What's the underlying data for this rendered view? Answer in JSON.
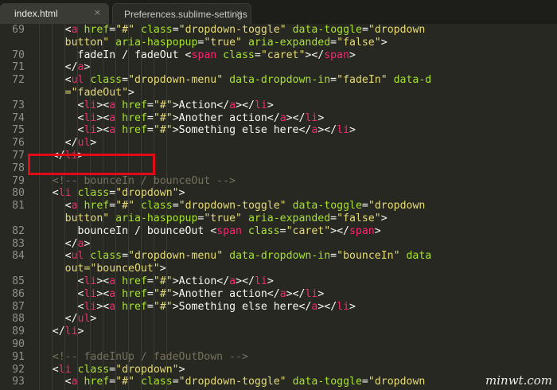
{
  "tabs": [
    {
      "label": "index.html",
      "close": "×",
      "active": true
    },
    {
      "label": "Preferences.sublime-settings",
      "close": "×",
      "active": false
    }
  ],
  "lines": [
    {
      "n": "69",
      "tokens": [
        [
          "p",
          "      "
        ],
        [
          "p",
          "<"
        ],
        [
          "t",
          "a"
        ],
        [
          "p",
          " "
        ],
        [
          "a",
          "href"
        ],
        [
          "p",
          "="
        ],
        [
          "s",
          "\"#\""
        ],
        [
          "p",
          " "
        ],
        [
          "a",
          "class"
        ],
        [
          "p",
          "="
        ],
        [
          "s",
          "\"dropdown-toggle\""
        ],
        [
          "p",
          " "
        ],
        [
          "a",
          "data-toggle"
        ],
        [
          "p",
          "="
        ],
        [
          "s",
          "\"dropdown"
        ]
      ]
    },
    {
      "n": "",
      "tokens": [
        [
          "s",
          "      button\""
        ],
        [
          "p",
          " "
        ],
        [
          "a",
          "aria-haspopup"
        ],
        [
          "p",
          "="
        ],
        [
          "s",
          "\"true\""
        ],
        [
          "p",
          " "
        ],
        [
          "a",
          "aria-expanded"
        ],
        [
          "p",
          "="
        ],
        [
          "s",
          "\"false\""
        ],
        [
          "p",
          ">"
        ]
      ]
    },
    {
      "n": "70",
      "tokens": [
        [
          "p",
          "        fadeIn / fadeOut "
        ],
        [
          "p",
          "<"
        ],
        [
          "t",
          "span"
        ],
        [
          "p",
          " "
        ],
        [
          "a",
          "class"
        ],
        [
          "p",
          "="
        ],
        [
          "s",
          "\"caret\""
        ],
        [
          "p",
          "></"
        ],
        [
          "t",
          "span"
        ],
        [
          "p",
          ">"
        ]
      ]
    },
    {
      "n": "71",
      "tokens": [
        [
          "p",
          "      </"
        ],
        [
          "t",
          "a"
        ],
        [
          "p",
          ">"
        ]
      ]
    },
    {
      "n": "72",
      "tokens": [
        [
          "p",
          "      <"
        ],
        [
          "t",
          "ul"
        ],
        [
          "p",
          " "
        ],
        [
          "a",
          "class"
        ],
        [
          "p",
          "="
        ],
        [
          "s",
          "\"dropdown-menu\""
        ],
        [
          "p",
          " "
        ],
        [
          "a",
          "data-dropdown-in"
        ],
        [
          "p",
          "="
        ],
        [
          "s",
          "\"fadeIn\""
        ],
        [
          "p",
          " "
        ],
        [
          "a",
          "data-d"
        ]
      ]
    },
    {
      "n": "",
      "tokens": [
        [
          "s",
          "      =\"fadeOut\""
        ],
        [
          "p",
          ">"
        ]
      ]
    },
    {
      "n": "73",
      "tokens": [
        [
          "p",
          "        <"
        ],
        [
          "t",
          "li"
        ],
        [
          "p",
          "><"
        ],
        [
          "t",
          "a"
        ],
        [
          "p",
          " "
        ],
        [
          "a",
          "href"
        ],
        [
          "p",
          "="
        ],
        [
          "s",
          "\"#\""
        ],
        [
          "p",
          ">Action</"
        ],
        [
          "t",
          "a"
        ],
        [
          "p",
          "></"
        ],
        [
          "t",
          "li"
        ],
        [
          "p",
          ">"
        ]
      ]
    },
    {
      "n": "74",
      "tokens": [
        [
          "p",
          "        <"
        ],
        [
          "t",
          "li"
        ],
        [
          "p",
          "><"
        ],
        [
          "t",
          "a"
        ],
        [
          "p",
          " "
        ],
        [
          "a",
          "href"
        ],
        [
          "p",
          "="
        ],
        [
          "s",
          "\"#\""
        ],
        [
          "p",
          ">Another action</"
        ],
        [
          "t",
          "a"
        ],
        [
          "p",
          "></"
        ],
        [
          "t",
          "li"
        ],
        [
          "p",
          ">"
        ]
      ]
    },
    {
      "n": "75",
      "tokens": [
        [
          "p",
          "        <"
        ],
        [
          "t",
          "li"
        ],
        [
          "p",
          "><"
        ],
        [
          "t",
          "a"
        ],
        [
          "p",
          " "
        ],
        [
          "a",
          "href"
        ],
        [
          "p",
          "="
        ],
        [
          "s",
          "\"#\""
        ],
        [
          "p",
          ">Something else here</"
        ],
        [
          "t",
          "a"
        ],
        [
          "p",
          "></"
        ],
        [
          "t",
          "li"
        ],
        [
          "p",
          ">"
        ]
      ]
    },
    {
      "n": "76",
      "tokens": [
        [
          "p",
          "      </"
        ],
        [
          "t",
          "ul"
        ],
        [
          "p",
          ">"
        ]
      ]
    },
    {
      "n": "77",
      "tokens": [
        [
          "p",
          "    </"
        ],
        [
          "t",
          "li"
        ],
        [
          "p",
          ">"
        ]
      ]
    },
    {
      "n": "78",
      "tokens": []
    },
    {
      "n": "79",
      "tokens": [
        [
          "c",
          "    <!-- bounceIn / bounceOut -->"
        ]
      ]
    },
    {
      "n": "80",
      "tokens": [
        [
          "p",
          "    <"
        ],
        [
          "t",
          "li"
        ],
        [
          "p",
          " "
        ],
        [
          "a",
          "class"
        ],
        [
          "p",
          "="
        ],
        [
          "s",
          "\"dropdown\""
        ],
        [
          "p",
          ">"
        ]
      ]
    },
    {
      "n": "81",
      "tokens": [
        [
          "p",
          "      <"
        ],
        [
          "t",
          "a"
        ],
        [
          "p",
          " "
        ],
        [
          "a",
          "href"
        ],
        [
          "p",
          "="
        ],
        [
          "s",
          "\"#\""
        ],
        [
          "p",
          " "
        ],
        [
          "a",
          "class"
        ],
        [
          "p",
          "="
        ],
        [
          "s",
          "\"dropdown-toggle\""
        ],
        [
          "p",
          " "
        ],
        [
          "a",
          "data-toggle"
        ],
        [
          "p",
          "="
        ],
        [
          "s",
          "\"dropdown"
        ]
      ]
    },
    {
      "n": "",
      "tokens": [
        [
          "s",
          "      button\""
        ],
        [
          "p",
          " "
        ],
        [
          "a",
          "aria-haspopup"
        ],
        [
          "p",
          "="
        ],
        [
          "s",
          "\"true\""
        ],
        [
          "p",
          " "
        ],
        [
          "a",
          "aria-expanded"
        ],
        [
          "p",
          "="
        ],
        [
          "s",
          "\"false\""
        ],
        [
          "p",
          ">"
        ]
      ]
    },
    {
      "n": "82",
      "tokens": [
        [
          "p",
          "        bounceIn / bounceOut "
        ],
        [
          "p",
          "<"
        ],
        [
          "t",
          "span"
        ],
        [
          "p",
          " "
        ],
        [
          "a",
          "class"
        ],
        [
          "p",
          "="
        ],
        [
          "s",
          "\"caret\""
        ],
        [
          "p",
          "></"
        ],
        [
          "t",
          "span"
        ],
        [
          "p",
          ">"
        ]
      ]
    },
    {
      "n": "83",
      "tokens": [
        [
          "p",
          "      </"
        ],
        [
          "t",
          "a"
        ],
        [
          "p",
          ">"
        ]
      ]
    },
    {
      "n": "84",
      "tokens": [
        [
          "p",
          "      <"
        ],
        [
          "t",
          "ul"
        ],
        [
          "p",
          " "
        ],
        [
          "a",
          "class"
        ],
        [
          "p",
          "="
        ],
        [
          "s",
          "\"dropdown-menu\""
        ],
        [
          "p",
          " "
        ],
        [
          "a",
          "data-dropdown-in"
        ],
        [
          "p",
          "="
        ],
        [
          "s",
          "\"bounceIn\""
        ],
        [
          "p",
          " "
        ],
        [
          "a",
          "data"
        ]
      ]
    },
    {
      "n": "",
      "tokens": [
        [
          "s",
          "      out=\"bounceOut\""
        ],
        [
          "p",
          ">"
        ]
      ]
    },
    {
      "n": "85",
      "tokens": [
        [
          "p",
          "        <"
        ],
        [
          "t",
          "li"
        ],
        [
          "p",
          "><"
        ],
        [
          "t",
          "a"
        ],
        [
          "p",
          " "
        ],
        [
          "a",
          "href"
        ],
        [
          "p",
          "="
        ],
        [
          "s",
          "\"#\""
        ],
        [
          "p",
          ">Action</"
        ],
        [
          "t",
          "a"
        ],
        [
          "p",
          "></"
        ],
        [
          "t",
          "li"
        ],
        [
          "p",
          ">"
        ]
      ]
    },
    {
      "n": "86",
      "tokens": [
        [
          "p",
          "        <"
        ],
        [
          "t",
          "li"
        ],
        [
          "p",
          "><"
        ],
        [
          "t",
          "a"
        ],
        [
          "p",
          " "
        ],
        [
          "a",
          "href"
        ],
        [
          "p",
          "="
        ],
        [
          "s",
          "\"#\""
        ],
        [
          "p",
          ">Another action</"
        ],
        [
          "t",
          "a"
        ],
        [
          "p",
          "></"
        ],
        [
          "t",
          "li"
        ],
        [
          "p",
          ">"
        ]
      ]
    },
    {
      "n": "87",
      "tokens": [
        [
          "p",
          "        <"
        ],
        [
          "t",
          "li"
        ],
        [
          "p",
          "><"
        ],
        [
          "t",
          "a"
        ],
        [
          "p",
          " "
        ],
        [
          "a",
          "href"
        ],
        [
          "p",
          "="
        ],
        [
          "s",
          "\"#\""
        ],
        [
          "p",
          ">Something else here</"
        ],
        [
          "t",
          "a"
        ],
        [
          "p",
          "></"
        ],
        [
          "t",
          "li"
        ],
        [
          "p",
          ">"
        ]
      ]
    },
    {
      "n": "88",
      "tokens": [
        [
          "p",
          "      </"
        ],
        [
          "t",
          "ul"
        ],
        [
          "p",
          ">"
        ]
      ]
    },
    {
      "n": "89",
      "tokens": [
        [
          "p",
          "    </"
        ],
        [
          "t",
          "li"
        ],
        [
          "p",
          ">"
        ]
      ]
    },
    {
      "n": "90",
      "tokens": []
    },
    {
      "n": "91",
      "tokens": [
        [
          "c",
          "    <!-- fadeInUp / fadeOutDown -->"
        ]
      ]
    },
    {
      "n": "92",
      "tokens": [
        [
          "p",
          "    <"
        ],
        [
          "t",
          "li"
        ],
        [
          "p",
          " "
        ],
        [
          "a",
          "class"
        ],
        [
          "p",
          "="
        ],
        [
          "s",
          "\"dropdown\""
        ],
        [
          "p",
          ">"
        ]
      ]
    },
    {
      "n": "93",
      "tokens": [
        [
          "p",
          "      <"
        ],
        [
          "t",
          "a"
        ],
        [
          "p",
          " "
        ],
        [
          "a",
          "href"
        ],
        [
          "p",
          "="
        ],
        [
          "s",
          "\"#\""
        ],
        [
          "p",
          " "
        ],
        [
          "a",
          "class"
        ],
        [
          "p",
          "="
        ],
        [
          "s",
          "\"dropdown-toggle\""
        ],
        [
          "p",
          " "
        ],
        [
          "a",
          "data-toggle"
        ],
        [
          "p",
          "="
        ],
        [
          "s",
          "\"dropdown"
        ]
      ]
    }
  ],
  "watermark": "minwt.com",
  "colors": {
    "background": "#272822",
    "tag": "#f92672",
    "attribute": "#a6e22e",
    "string": "#e6db74",
    "comment": "#75715e",
    "text": "#f8f8f2",
    "highlight": "#e30a17"
  }
}
